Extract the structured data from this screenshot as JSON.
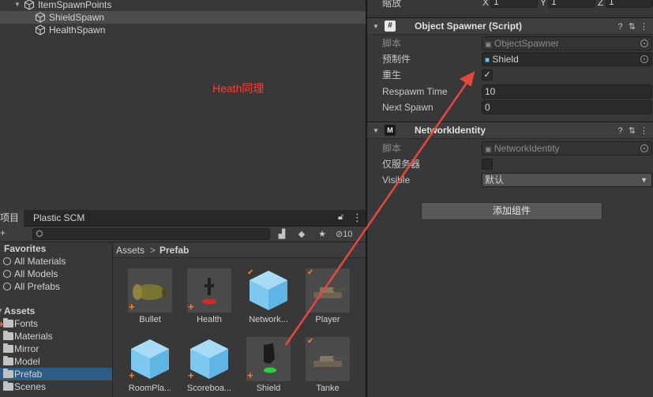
{
  "hierarchy": {
    "parent": "ItemSpawnPoints",
    "children": [
      "ShieldSpawn",
      "HealthSpawn"
    ],
    "note": "Heath同理"
  },
  "project": {
    "tabs": [
      "项目",
      "Plastic SCM"
    ],
    "hidden_count": "10",
    "favorites": {
      "title": "Favorites",
      "items": [
        "All Materials",
        "All Models",
        "All Prefabs"
      ]
    },
    "assets": {
      "title": "Assets",
      "folders": [
        "Fonts",
        "Materials",
        "Mirror",
        "Model",
        "Prefab",
        "Scenes"
      ]
    },
    "breadcrumb": {
      "root": "Assets",
      "sep": ">",
      "current": "Prefab"
    },
    "items": [
      "Bullet",
      "Health",
      "Network...",
      "Player",
      "RoomPla...",
      "Scoreboa...",
      "Shield",
      "Tanke"
    ]
  },
  "inspector": {
    "scale": {
      "label": "缩放",
      "x": "1",
      "y": "1",
      "z": "1"
    },
    "object_spawner": {
      "title": "Object Spawner (Script)",
      "script_label": "脚本",
      "script_value": "ObjectSpawner",
      "prefab_label": "预制件",
      "prefab_value": "Shield",
      "respawn_label": "重生",
      "respawn_checked": "✓",
      "respawn_time_label": "Respawm Time",
      "respawn_time_value": "10",
      "next_spawn_label": "Next Spawn",
      "next_spawn_value": "0"
    },
    "network_identity": {
      "title": "NetworkIdentity",
      "script_label": "脚本",
      "script_value": "NetworkIdentity",
      "server_only_label": "仅服务器",
      "visible_label": "Visible",
      "visible_value": "默认"
    },
    "add_component": "添加组件"
  },
  "colors": {
    "accent": "#2c5d87",
    "arrow": "#e8473c",
    "badge": "#ff7b2f"
  }
}
